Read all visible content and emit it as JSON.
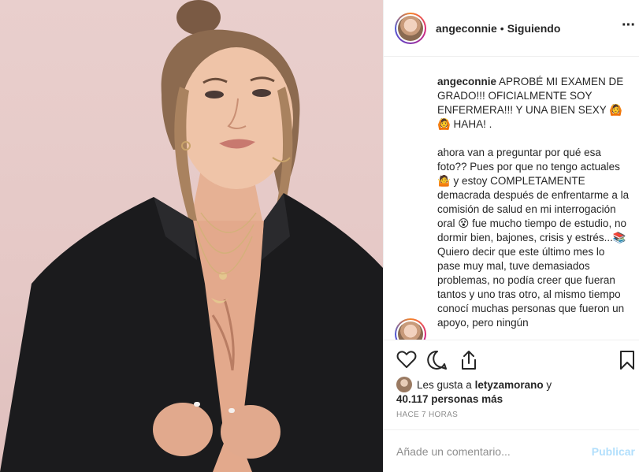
{
  "post": {
    "username": "angeconnie",
    "follow_separator": "•",
    "follow_status": "Siguiendo",
    "more_icon": "more-horizontal-icon"
  },
  "caption": {
    "username": "angeconnie",
    "text": " APROBÉ MI EXAMEN DE GRADO!!! OFICIALMENTE SOY ENFERMERA!!! Y UNA BIEN SEXY 🙆\n🙆 HAHA! .\n\nahora van a preguntar por qué esa foto?? Pues por que no tengo actuales 🤷 y estoy COMPLETAMENTE demacrada después de enfrentarme a la comisión de salud en mi interrogación oral 😵 fue mucho tiempo de estudio, no dormir bien, bajones, crisis y estrés...📚\nQuiero decir que este último mes lo pase muy mal, tuve demasiados problemas, no podía creer que fueran tantos y uno tras otro, al mismo tiempo conocí muchas personas que fueron un apoyo, pero ningún"
  },
  "actions": {
    "like_icon": "heart-icon",
    "comment_icon": "comment-icon",
    "share_icon": "share-icon",
    "save_icon": "bookmark-icon"
  },
  "likes": {
    "prefix": "Les gusta a ",
    "liked_by": "letyzamorano",
    "connector": " y",
    "count": "40.117 personas más"
  },
  "timestamp": "HACE 7 HORAS",
  "comment": {
    "placeholder": "Añade un comentario...",
    "publish_label": "Publicar"
  },
  "colors": {
    "photo_background": "#e5c8c6",
    "publish_disabled": "#b2dffc",
    "secondary_text": "#8e8e8e"
  }
}
